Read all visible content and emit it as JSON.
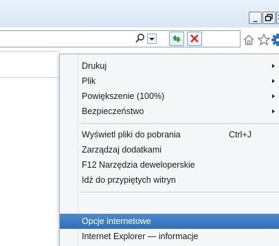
{
  "window": {
    "minimize_glyph": "_",
    "maximize_glyph": "🗗",
    "close_glyph": "✕"
  },
  "toolbar": {
    "icons": [
      "search-icon",
      "dropdown-arrow-icon",
      "refresh-icon",
      "stop-icon",
      "home-icon",
      "favorites-star-icon",
      "tools-gear-icon"
    ]
  },
  "menu": {
    "group1": [
      {
        "label": "Drukuj",
        "has_submenu": true
      },
      {
        "label": "Plik",
        "has_submenu": true
      },
      {
        "label": "Powiększenie (100%)",
        "has_submenu": true
      },
      {
        "label": "Bezpieczeństwo",
        "has_submenu": true
      }
    ],
    "group2": [
      {
        "label": "Wyświetl pliki do pobrania",
        "shortcut": "Ctrl+J"
      },
      {
        "label": "Zarządzaj dodatkami"
      },
      {
        "label": "F12 Narzędzia deweloperskie"
      },
      {
        "label": "Idź do przypiętych witryn"
      }
    ],
    "group3": [
      {
        "label": "Opcje internetowe",
        "highlighted": true
      },
      {
        "label": "Internet Explorer — informacje"
      }
    ]
  },
  "colors": {
    "highlight": "#3b7cc4",
    "menu_bg": "#f4f6f8",
    "refresh_green": "#2e9b3a",
    "stop_red": "#d42a2a",
    "gear_blue": "#2d6fb6"
  }
}
